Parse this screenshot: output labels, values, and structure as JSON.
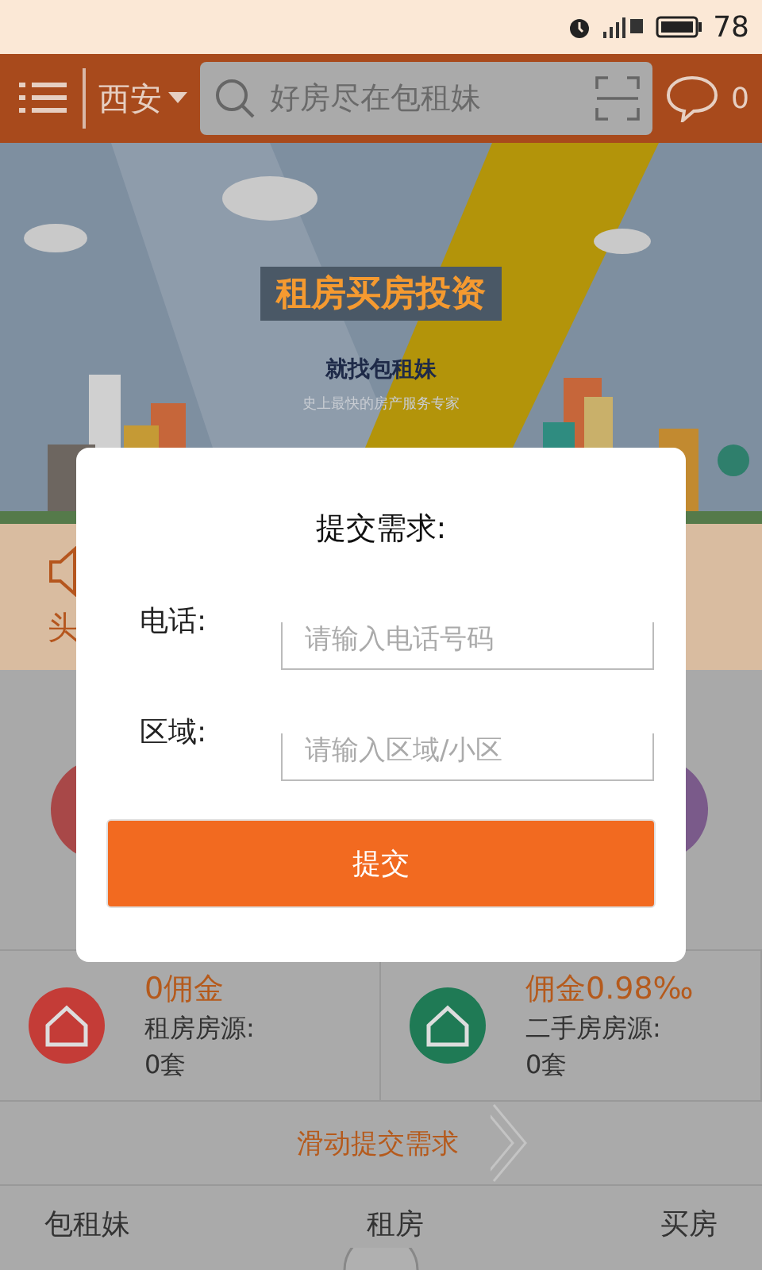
{
  "status_bar": {
    "battery": "78"
  },
  "header": {
    "city": "西安",
    "search": {
      "placeholder": "好房尽在包租妹"
    },
    "message_count": "0"
  },
  "banner": {
    "title": "租房买房投资",
    "subtitle": "就找包租妹",
    "tagline": "史上最快的房产服务专家"
  },
  "notice": {
    "text": "头"
  },
  "stats": [
    {
      "headline": "0佣金",
      "label": "租房房源:",
      "count": "0套",
      "color": "#c43c37"
    },
    {
      "headline": "佣金0.98‰",
      "label": "二手房房源:",
      "count": "0套",
      "color": "#1f7a55"
    }
  ],
  "slide_bar": {
    "label": "滑动提交需求"
  },
  "bottom_tabs": [
    {
      "label": "包租妹"
    },
    {
      "label": "租房"
    },
    {
      "label": "买房"
    }
  ],
  "dialog": {
    "title": "提交需求:",
    "fields": [
      {
        "label": "电话:",
        "placeholder": "请输入电话号码"
      },
      {
        "label": "区域:",
        "placeholder": "请输入区域/小区"
      }
    ],
    "submit": "提交"
  }
}
